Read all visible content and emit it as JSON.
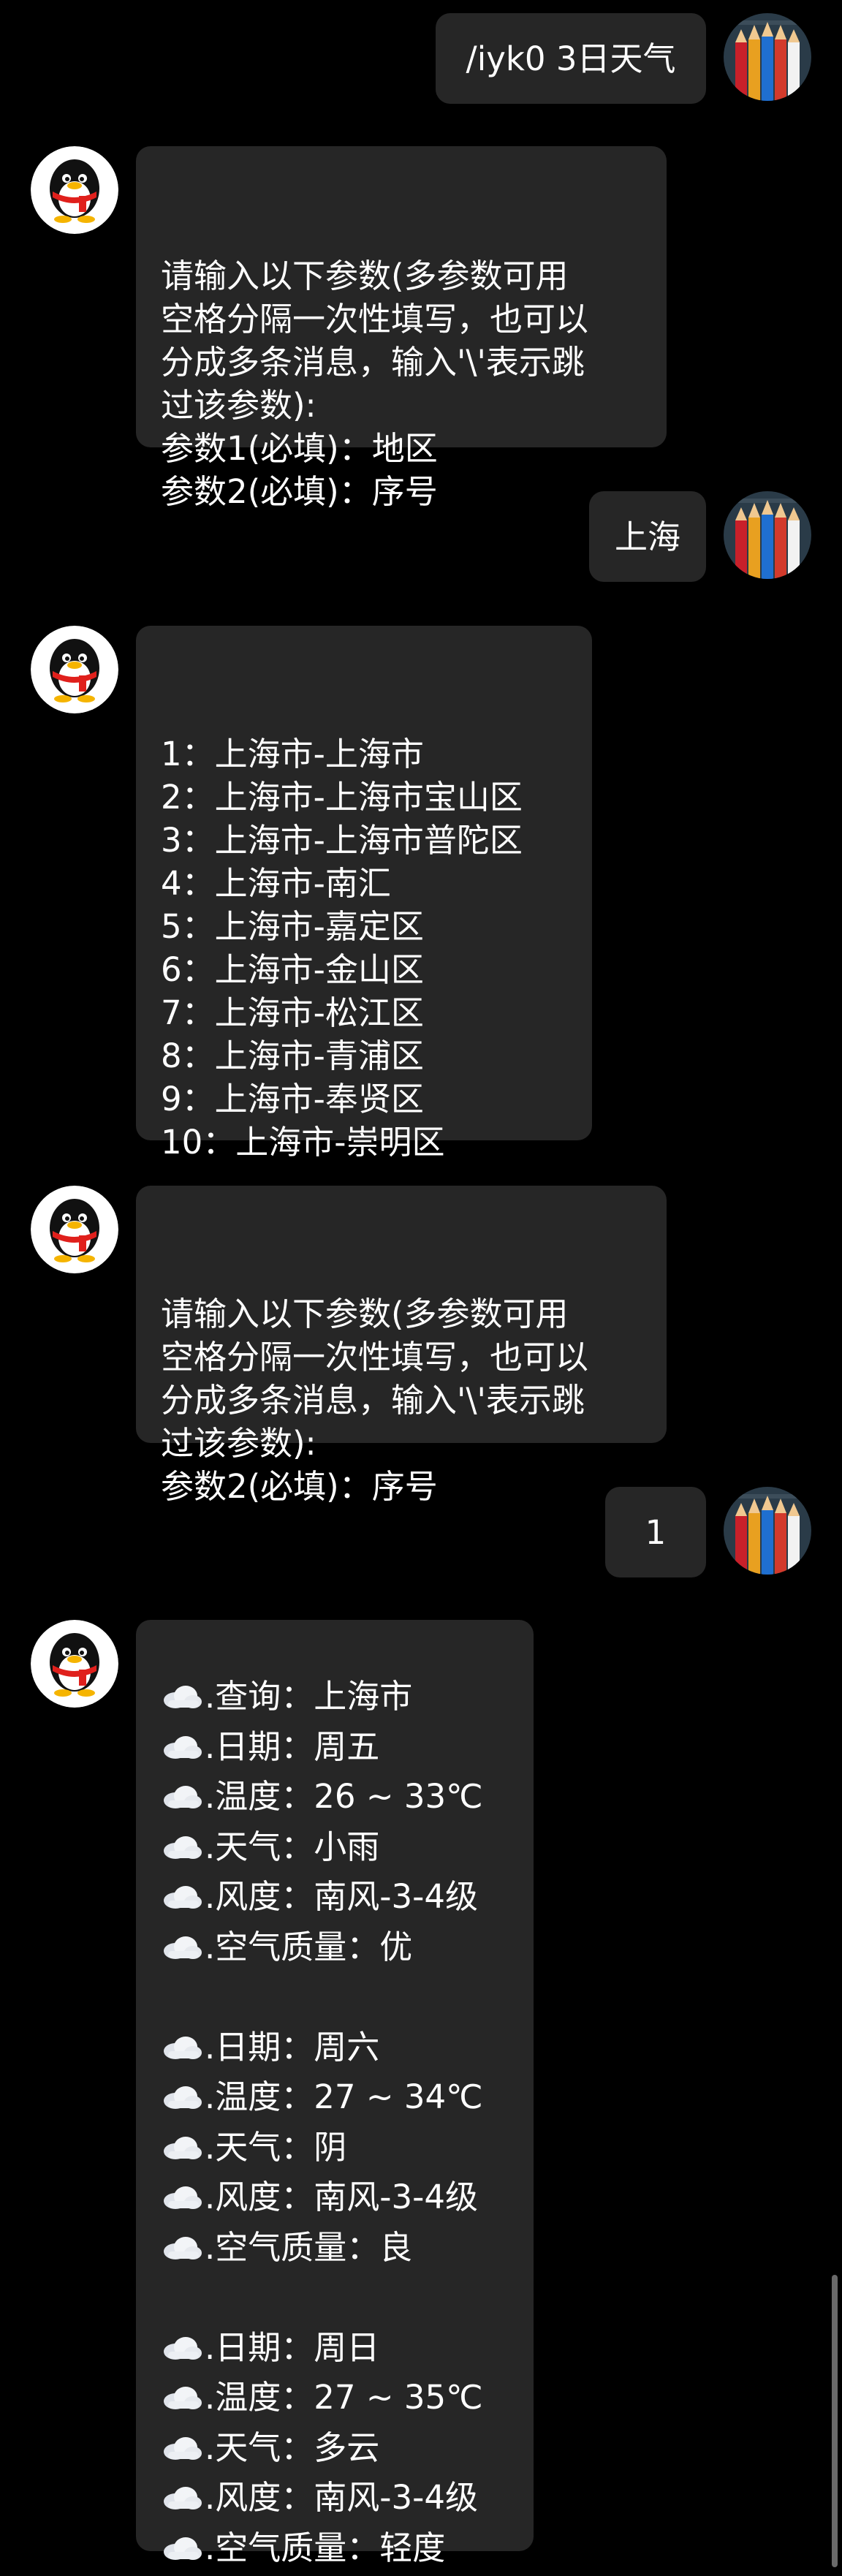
{
  "messages": {
    "m1": {
      "sender": "user",
      "text": "/iyk0 3日天气"
    },
    "m2": {
      "sender": "bot",
      "text": "请输入以下参数(多参数可用\n空格分隔一次性填写，也可以\n分成多条消息，输入'\\'表示跳\n过该参数):\n参数1(必填)：地区\n参数2(必填)：序号"
    },
    "m3": {
      "sender": "user",
      "text": "上海"
    },
    "m4": {
      "sender": "bot",
      "text": "1：上海市-上海市\n2：上海市-上海市宝山区\n3：上海市-上海市普陀区\n4：上海市-南汇\n5：上海市-嘉定区\n6：上海市-金山区\n7：上海市-松江区\n8：上海市-青浦区\n9：上海市-奉贤区\n10：上海市-崇明区"
    },
    "m5": {
      "sender": "bot",
      "text": "请输入以下参数(多参数可用\n空格分隔一次性填写，也可以\n分成多条消息，输入'\\'表示跳\n过该参数):\n参数2(必填)：序号"
    },
    "m6": {
      "sender": "user",
      "text": "1"
    },
    "m7": {
      "sender": "bot",
      "lines": [
        ".查询：上海市",
        ".日期：周五",
        ".温度：26 ~ 33℃",
        ".天气：小雨",
        ".风度：南风-3-4级",
        ".空气质量：优",
        "",
        ".日期：周六",
        ".温度：27 ~ 34℃",
        ".天气：阴",
        ".风度：南风-3-4级",
        ".空气质量：良",
        "",
        ".日期：周日",
        ".温度：27 ~ 35℃",
        ".天气：多云",
        ".风度：南风-3-4级",
        ".空气质量：轻度"
      ]
    }
  },
  "icons": {
    "bot_avatar": "penguin-icon",
    "user_avatar": "pencils-icon",
    "weather_line": "cloud-icon"
  },
  "colors": {
    "background": "#000000",
    "bubble": "#262626",
    "text": "#ffffff"
  }
}
